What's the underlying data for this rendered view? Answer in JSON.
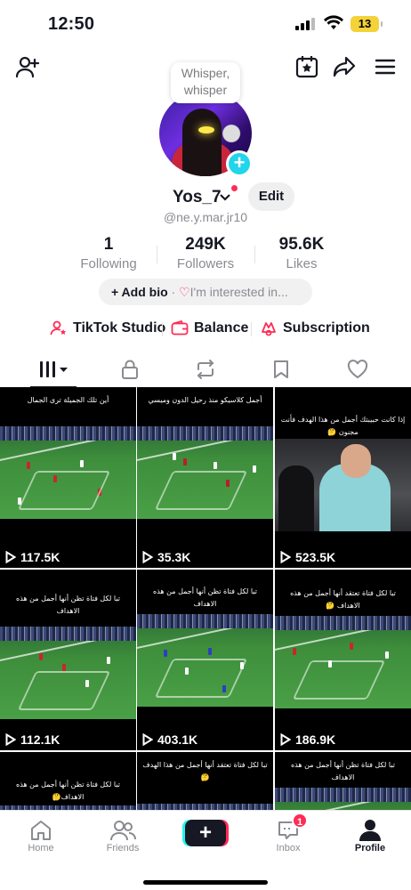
{
  "status": {
    "time": "12:50",
    "battery": "13"
  },
  "bubble": {
    "text": "Whisper, whisper"
  },
  "profile": {
    "username": "Yos_7",
    "handle": "@ne.y.mar.jr10",
    "edit_label": "Edit"
  },
  "stats": [
    {
      "value": "1",
      "label": "Following"
    },
    {
      "value": "249K",
      "label": "Followers"
    },
    {
      "value": "95.6K",
      "label": "Likes"
    }
  ],
  "bio": {
    "add_label": "+ Add bio",
    "dot": " · ",
    "interest": "I'm interested in..."
  },
  "tools": [
    {
      "label": "TikTok Studio",
      "icon": "person-star-icon"
    },
    {
      "label": "Balance",
      "icon": "wallet-icon"
    },
    {
      "label": "Subscription",
      "icon": "subscription-icon"
    }
  ],
  "tabs": [
    {
      "name": "videos-grid",
      "icon": "grid-icon"
    },
    {
      "name": "private",
      "icon": "lock-icon"
    },
    {
      "name": "reposts",
      "icon": "repost-icon"
    },
    {
      "name": "favorites",
      "icon": "bookmark-icon"
    },
    {
      "name": "liked",
      "icon": "heart-icon"
    }
  ],
  "videos": [
    {
      "caption": "أين تلك الجميلة ترى الجمال",
      "views": "117.5K",
      "scene": "pitch"
    },
    {
      "caption": "أجمل كلاسيكو منذ رحيل الدون وميسي",
      "views": "35.3K",
      "scene": "pitch"
    },
    {
      "caption": "إذا كانت حبيبتك أجمل من هذا الهدف فأنت مجنون 🤔",
      "views": "523.5K",
      "scene": "coach"
    },
    {
      "caption": "تبا لكل فتاة تظن أنها أجمل من هذه الاهداف",
      "views": "112.1K",
      "scene": "pitch"
    },
    {
      "caption": "تبا لكل فتاة تظن أنها أجمل من هذه الاهداف",
      "views": "403.1K",
      "scene": "pitch"
    },
    {
      "caption": "تبا لكل فتاة تعتقد أنها أجمل من هذه الاهداف 🤔",
      "views": "186.9K",
      "scene": "pitch"
    },
    {
      "caption": "تبا لكل فتاة تظن أنها أجمل من هذه الاهداف🤔",
      "views": "",
      "scene": "pitch"
    },
    {
      "caption": "تبا لكل فتاة تعتقد أنها أجمل من هذا الهدف 🤔",
      "views": "",
      "scene": "pitch"
    },
    {
      "caption": "تبا لكل فتاة تظن أنها أجمل من هذه الاهداف",
      "views": "",
      "scene": "pitch"
    }
  ],
  "nav": [
    {
      "label": "Home",
      "icon": "home-icon"
    },
    {
      "label": "Friends",
      "icon": "friends-icon"
    },
    {
      "label": "",
      "icon": "plus-icon"
    },
    {
      "label": "Inbox",
      "icon": "inbox-icon",
      "badge": "1"
    },
    {
      "label": "Profile",
      "icon": "profile-icon"
    }
  ],
  "colors": {
    "accent": "#fe2c55",
    "cyan": "#20d5ec"
  }
}
